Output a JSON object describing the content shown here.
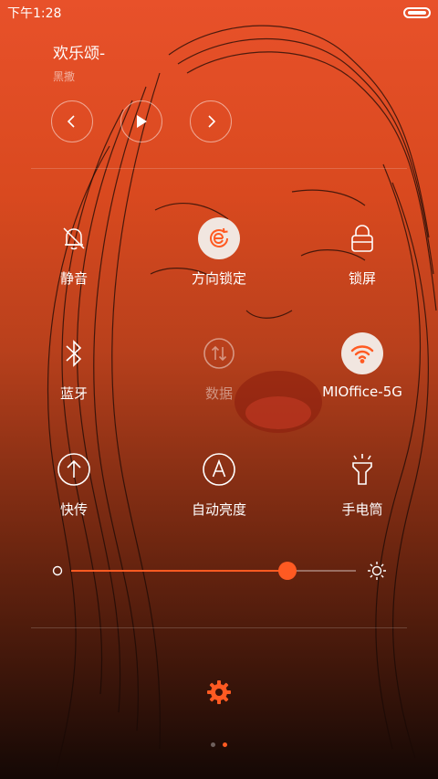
{
  "status_bar": {
    "time": "下午1:28",
    "battery_level": 1.0
  },
  "music": {
    "song": "欢乐颂-",
    "artist": "黑撒",
    "controls": [
      {
        "icon": "chevron-left-icon"
      },
      {
        "icon": "play-icon"
      },
      {
        "icon": "chevron-right-icon"
      }
    ]
  },
  "toggles": [
    {
      "id": "mute",
      "label": "静音",
      "icon": "bell-off-icon",
      "state": "off"
    },
    {
      "id": "rotation-lock",
      "label": "方向锁定",
      "icon": "rotation-lock-icon",
      "state": "on"
    },
    {
      "id": "lock-screen",
      "label": "锁屏",
      "icon": "lock-icon",
      "state": "off"
    },
    {
      "id": "bluetooth",
      "label": "蓝牙",
      "icon": "bluetooth-icon",
      "state": "off"
    },
    {
      "id": "data",
      "label": "数据",
      "icon": "data-transfer-icon",
      "state": "disabled"
    },
    {
      "id": "wifi",
      "label": "MIOffice-5G",
      "icon": "wifi-icon",
      "state": "on"
    },
    {
      "id": "quick-transfer",
      "label": "快传",
      "icon": "upload-icon",
      "state": "off"
    },
    {
      "id": "auto-brightness",
      "label": "自动亮度",
      "icon": "auto-brightness-icon",
      "state": "off"
    },
    {
      "id": "flashlight",
      "label": "手电筒",
      "icon": "flashlight-icon",
      "state": "off"
    }
  ],
  "brightness": {
    "value": 0.76,
    "low_icon": "brightness-low-icon",
    "high_icon": "sun-icon"
  },
  "settings_icon": "gear-icon",
  "pager": {
    "pages": 2,
    "current": 2
  },
  "colors": {
    "accent": "#ff5a22",
    "active_toggle_bg": "#f1e6e0"
  }
}
